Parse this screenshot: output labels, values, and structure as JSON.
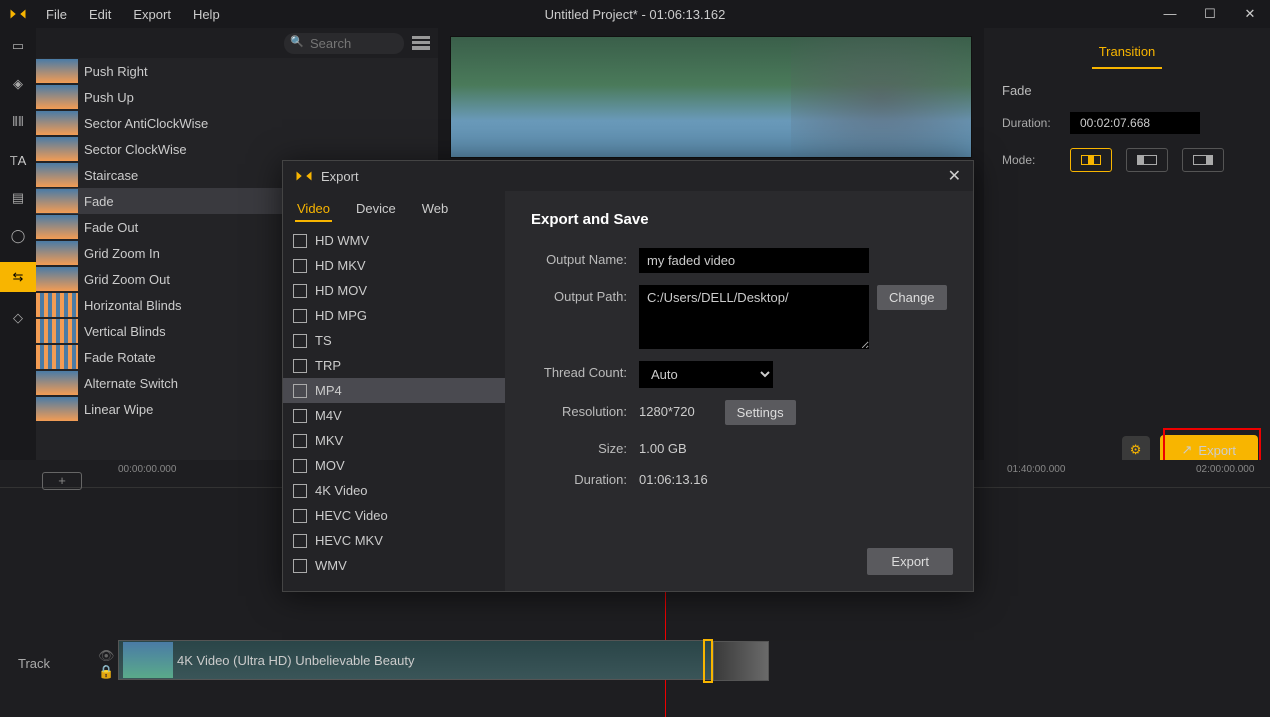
{
  "title": "Untitled Project* - 01:06:13.162",
  "menu": [
    "File",
    "Edit",
    "Export",
    "Help"
  ],
  "search_placeholder": "Search",
  "right": {
    "tab": "Transition",
    "header": "Fade",
    "dur_lbl": "Duration:",
    "dur_val": "00:02:07.668",
    "mode_lbl": "Mode:"
  },
  "transitions": [
    "Push Right",
    "Push Up",
    "Sector AntiClockWise",
    "Sector ClockWise",
    "Staircase",
    "Fade",
    "Fade Out",
    "Grid Zoom In",
    "Grid Zoom Out",
    "Horizontal Blinds",
    "Vertical Blinds",
    "Fade Rotate",
    "Alternate Switch",
    "Linear Wipe"
  ],
  "transition_selected": "Fade",
  "export_btn": "Export",
  "timeline": {
    "add": "+",
    "ticks": [
      {
        "p": 118,
        "t": "00:00:00.000"
      },
      {
        "p": 1007,
        "t": "01:40:00.000"
      },
      {
        "p": 1196,
        "t": "02:00:00.000"
      }
    ],
    "track_label": "Track",
    "clip_name": "4K Video (Ultra HD) Unbelievable Beauty"
  },
  "dialog": {
    "title": "Export",
    "tabs": [
      "Video",
      "Device",
      "Web"
    ],
    "tab_active": "Video",
    "formats": [
      "HD WMV",
      "HD MKV",
      "HD MOV",
      "HD MPG",
      "TS",
      "TRP",
      "MP4",
      "M4V",
      "MKV",
      "MOV",
      "4K Video",
      "HEVC Video",
      "HEVC MKV",
      "WMV"
    ],
    "format_selected": "MP4",
    "heading": "Export and Save",
    "name_lbl": "Output Name:",
    "name_val": "my faded video",
    "path_lbl": "Output Path:",
    "path_val": "C:/Users/DELL/Desktop/",
    "change": "Change",
    "thread_lbl": "Thread Count:",
    "thread_val": "Auto",
    "res_lbl": "Resolution:",
    "res_val": "1280*720",
    "settings": "Settings",
    "size_lbl": "Size:",
    "size_val": "1.00 GB",
    "dur_lbl": "Duration:",
    "dur_val": "01:06:13.16",
    "export": "Export"
  }
}
